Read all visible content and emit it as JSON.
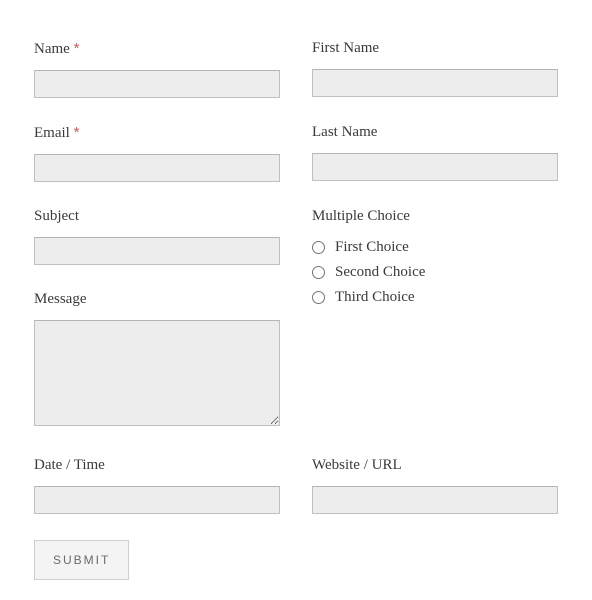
{
  "fields": {
    "name": {
      "label": "Name",
      "required": true,
      "value": ""
    },
    "first_name": {
      "label": "First Name",
      "value": ""
    },
    "email": {
      "label": "Email",
      "required": true,
      "value": ""
    },
    "last_name": {
      "label": "Last Name",
      "value": ""
    },
    "subject": {
      "label": "Subject",
      "value": ""
    },
    "multiple_choice": {
      "label": "Multiple Choice",
      "options": [
        "First Choice",
        "Second Choice",
        "Third Choice"
      ],
      "selected": null
    },
    "message": {
      "label": "Message",
      "value": ""
    },
    "date_time": {
      "label": "Date / Time",
      "value": ""
    },
    "website_url": {
      "label": "Website / URL",
      "value": ""
    }
  },
  "buttons": {
    "submit": "SUBMIT"
  },
  "required_marker": "*"
}
